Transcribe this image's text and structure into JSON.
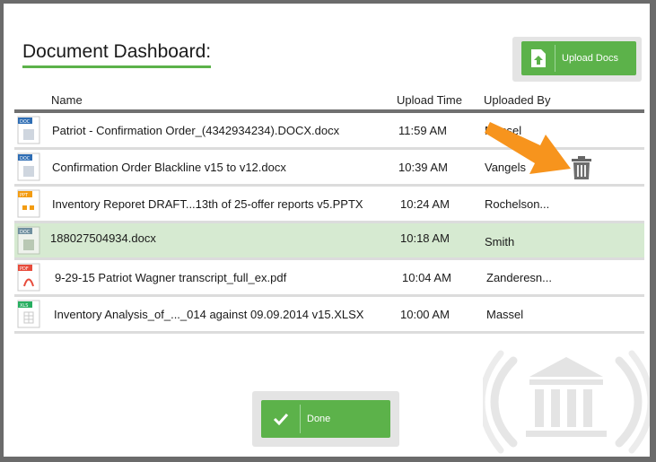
{
  "header": {
    "title": "Document Dashboard:"
  },
  "upload": {
    "label": "Upload Docs",
    "icon": "upload-icon"
  },
  "table": {
    "columns": {
      "name": "Name",
      "upload_time": "Upload Time",
      "uploaded_by": "Uploaded By"
    },
    "rows": [
      {
        "name": "Patriot - Confirmation Order_(4342934234).DOCX.docx",
        "time": "11:59 AM",
        "by": "Massel",
        "type": "DOC",
        "selected": false
      },
      {
        "name": "Confirmation Order Blackline v15 to v12.docx",
        "time": "10:39 AM",
        "by": "Vangels",
        "type": "DOC",
        "selected": false
      },
      {
        "name": "Inventory Reporet DRAFT...13th of 25-offer reports v5.PPTX",
        "time": "10:24 AM",
        "by": "Rochelson...",
        "type": "PPT",
        "selected": false
      },
      {
        "name": "188027504934.docx",
        "time": "10:18 AM",
        "by": "Smith",
        "type": "DOC",
        "selected": true
      },
      {
        "name": "9-29-15 Patriot Wagner transcript_full_ex.pdf",
        "time": "10:04 AM",
        "by": "Zanderesn...",
        "type": "PDF",
        "selected": false
      },
      {
        "name": "Inventory Analysis_of_..._014 against 09.09.2014 v15.XLSX",
        "time": "10:00 AM",
        "by": "Massel",
        "type": "XLS",
        "selected": false
      }
    ]
  },
  "done": {
    "label": "Done",
    "icon": "checkmark-icon"
  },
  "colors": {
    "accent": "#5cb24a",
    "selected_row": "#d6ead1",
    "arrow": "#f7941d",
    "doc": "#2e6db4",
    "ppt": "#f39c12",
    "pdf": "#e74c3c",
    "xls": "#27ae60"
  }
}
